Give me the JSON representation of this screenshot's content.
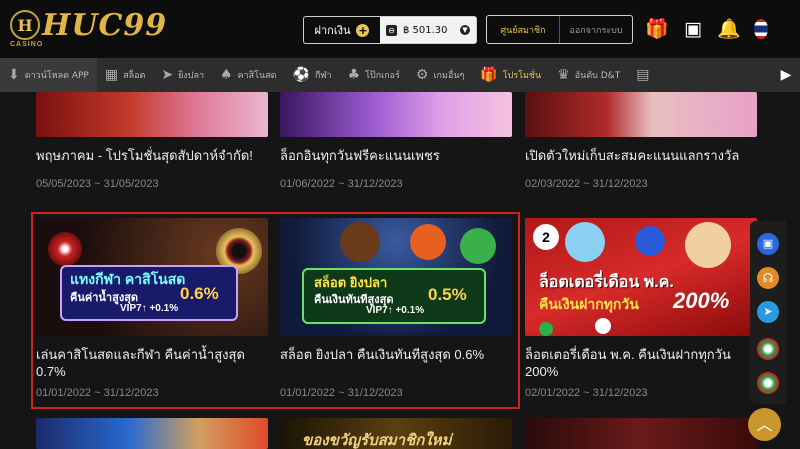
{
  "header": {
    "logo_letter": "H",
    "logo_text": "HUC99",
    "logo_sub": "CASINO",
    "deposit_label": "ฝากเงิน",
    "plus": "+",
    "balance": "฿ 501.30",
    "member_label": "ศูนย์สมาชิก",
    "logout_label": "ออกจากระบบ"
  },
  "nav": {
    "items": [
      {
        "label": "ดาวน์โหลด APP",
        "icon": "download-icon",
        "glyph": "⬇"
      },
      {
        "label": "สล็อต",
        "icon": "slot-icon",
        "glyph": "▦"
      },
      {
        "label": "ยิงปลา",
        "icon": "fish-icon",
        "glyph": "➤"
      },
      {
        "label": "คาสิโนสด",
        "icon": "casino-icon",
        "glyph": "♠"
      },
      {
        "label": "กีฬา",
        "icon": "football-icon",
        "glyph": "⚽"
      },
      {
        "label": "โป๊กเกอร์",
        "icon": "poker-icon",
        "glyph": "♣"
      },
      {
        "label": "เกมอื่นๆ",
        "icon": "game-icon",
        "glyph": "⚙"
      },
      {
        "label": "โปรโมชั่น",
        "icon": "gift-icon",
        "glyph": "🎁"
      },
      {
        "label": "อันดับ D&T",
        "icon": "crown-icon",
        "glyph": "♛"
      }
    ],
    "active_index": 7
  },
  "promos": {
    "row1": [
      {
        "title": "พฤษภาคม - โปรโมชั่นสุดสัปดาห์จำกัด!",
        "date": "05/05/2023 ~ 31/05/2023"
      },
      {
        "title": "ล็อกอินทุกวันฟรีคะแนนเพชร",
        "date": "01/06/2022 ~ 31/12/2023"
      },
      {
        "title": "เปิดตัวใหม่เก็บสะสมคะแนนแลกรางวัล",
        "date": "02/03/2022 ~ 31/12/2023"
      }
    ],
    "row2": [
      {
        "title": "เล่นคาสิโนสดและกีฬา คืนค่าน้ำสูงสุด 0.7%",
        "date": "01/01/2022 ~ 31/12/2023",
        "banner_line1": "แทงกีฬา คาสิโนสด",
        "banner_line2": "คืนค่าน้ำสูงสุด",
        "banner_pct": "0.6%",
        "banner_vip": "VIP7↑ +0.1%"
      },
      {
        "title": "สล็อต ยิงปลา คืนเงินทันทีสูงสุด 0.6%",
        "date": "01/01/2022 ~ 31/12/2023",
        "banner_line1": "สล็อต ยิงปลา",
        "banner_line2": "คืนเงินทันทีสูงสุด",
        "banner_pct": "0.5%",
        "banner_vip": "VIP7↑ +0.1%"
      },
      {
        "title": "ล็อตเตอรี่เดือน พ.ค. คืนเงินฝากทุกวัน 200%",
        "date": "02/01/2022 ~ 31/12/2023",
        "banner_line1": "ล็อตเตอรี่เดือน พ.ค.",
        "banner_line2": "คืนเงินฝากทุกวัน",
        "banner_pct": "200%"
      }
    ],
    "row3_banner": "ของขวัญรับสมาชิกใหม่"
  },
  "colors": {
    "accent": "#e8c25a",
    "highlight": "#d02020"
  }
}
